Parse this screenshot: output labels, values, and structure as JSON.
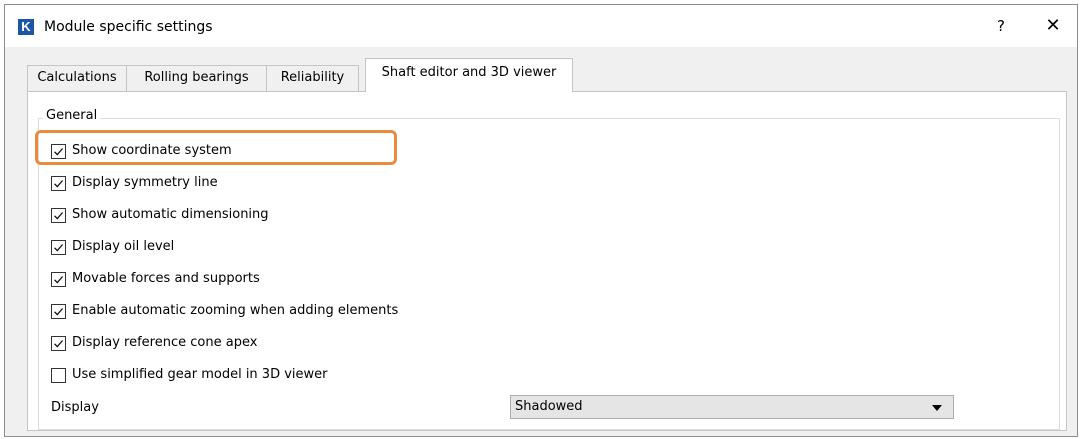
{
  "window": {
    "logo_letter": "K",
    "title": "Module specific settings",
    "help_label": "?",
    "close_label": "✕"
  },
  "tabs": [
    {
      "label": "Calculations",
      "active": false
    },
    {
      "label": "Rolling bearings",
      "active": false
    },
    {
      "label": "Reliability",
      "active": false
    },
    {
      "label": "Shaft editor and 3D viewer",
      "active": true
    }
  ],
  "general": {
    "legend": "General",
    "options": [
      {
        "label": "Show coordinate system",
        "checked": true
      },
      {
        "label": "Display symmetry line",
        "checked": true
      },
      {
        "label": "Show automatic dimensioning",
        "checked": true
      },
      {
        "label": "Display oil level",
        "checked": true
      },
      {
        "label": "Movable forces and supports",
        "checked": true
      },
      {
        "label": "Enable automatic zooming when adding elements",
        "checked": true
      },
      {
        "label": "Display reference cone apex",
        "checked": true
      },
      {
        "label": "Use simplified gear model in 3D viewer",
        "checked": false
      }
    ],
    "display_label": "Display",
    "display_value": "Shadowed"
  },
  "colors": {
    "highlight": "#e98a3c",
    "logo_bg": "#1d56a6"
  }
}
